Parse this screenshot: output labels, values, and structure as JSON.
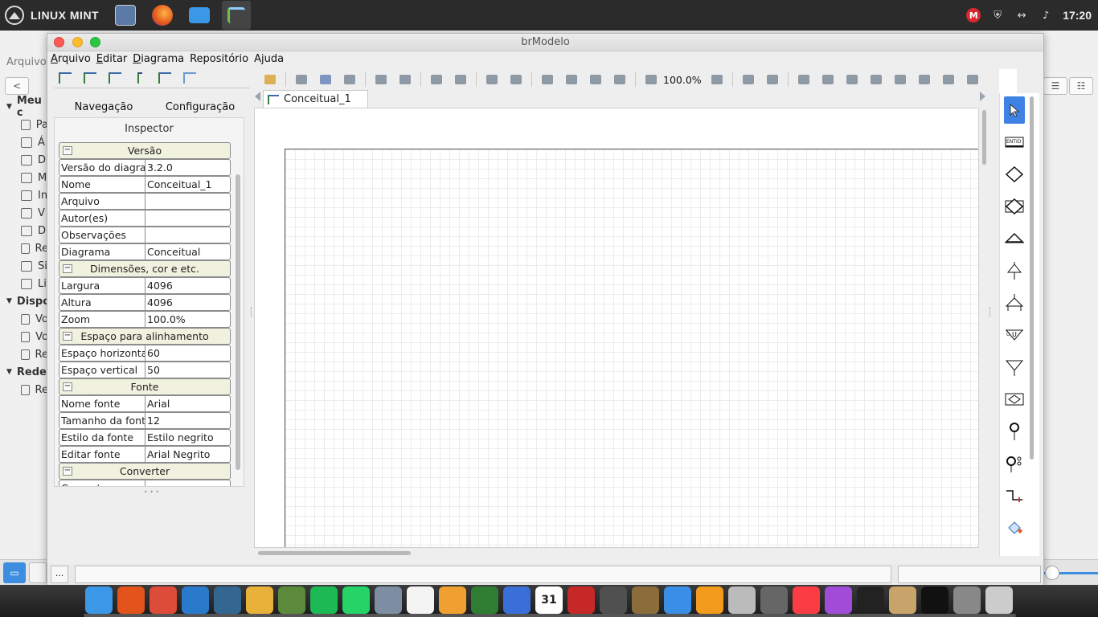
{
  "top_panel": {
    "brand": "LINUX MINT",
    "launchers": [
      "app-icon",
      "firefox-icon",
      "files-icon",
      "brmodelo-icon"
    ],
    "clock": "17:20"
  },
  "background_app": {
    "menu": "Arquivo",
    "sidebar": [
      {
        "type": "section",
        "label": "Meu c"
      },
      {
        "type": "item",
        "label": "Pa"
      },
      {
        "type": "item",
        "label": "Á"
      },
      {
        "type": "item",
        "label": "D"
      },
      {
        "type": "item",
        "label": "M"
      },
      {
        "type": "item",
        "label": "In"
      },
      {
        "type": "item",
        "label": "V"
      },
      {
        "type": "item",
        "label": "D"
      },
      {
        "type": "item",
        "label": "Re"
      },
      {
        "type": "item",
        "label": "Si"
      },
      {
        "type": "item",
        "label": "Li"
      },
      {
        "type": "section",
        "label": "Dispo"
      },
      {
        "type": "item",
        "label": "Vo"
      },
      {
        "type": "item",
        "label": "Vo"
      },
      {
        "type": "item",
        "label": "Re"
      },
      {
        "type": "section",
        "label": "Rede"
      },
      {
        "type": "item",
        "label": "Re"
      }
    ]
  },
  "window": {
    "title": "brModelo",
    "menu": [
      {
        "first": "A",
        "rest": "rquivo"
      },
      {
        "first": "E",
        "rest": "ditar"
      },
      {
        "first": "D",
        "rest": "iagrama"
      },
      {
        "first": "",
        "rest": "Repositório"
      },
      {
        "first": "",
        "rest": "Ajuda"
      }
    ],
    "left_tabs": [
      "Navegação",
      "Configuração"
    ],
    "inspector_title": "Inspector",
    "properties": [
      {
        "type": "section",
        "label": "Versão"
      },
      {
        "type": "row",
        "key": "Versão do diagra",
        "value": "3.2.0"
      },
      {
        "type": "row",
        "key": "Nome",
        "value": "Conceitual_1"
      },
      {
        "type": "row",
        "key": "Arquivo",
        "value": ""
      },
      {
        "type": "row",
        "key": "Autor(es)",
        "value": ""
      },
      {
        "type": "row",
        "key": "Observações",
        "value": ""
      },
      {
        "type": "row",
        "key": "Diagrama",
        "value": "Conceitual"
      },
      {
        "type": "section",
        "label": "Dimensões, cor e etc."
      },
      {
        "type": "row",
        "key": "Largura",
        "value": "4096"
      },
      {
        "type": "row",
        "key": "Altura",
        "value": "4096"
      },
      {
        "type": "row",
        "key": "Zoom",
        "value": "100.0%"
      },
      {
        "type": "section",
        "label": "Espaço para alinhamento"
      },
      {
        "type": "row",
        "key": "Espaço horizonta",
        "value": "60"
      },
      {
        "type": "row",
        "key": "Espaço vertical",
        "value": "50"
      },
      {
        "type": "section",
        "label": "Fonte"
      },
      {
        "type": "row",
        "key": "Nome fonte",
        "value": "Arial"
      },
      {
        "type": "row",
        "key": "Tamanho da font",
        "value": "12"
      },
      {
        "type": "row",
        "key": "Estilo da fonte",
        "value": "Estilo negrito"
      },
      {
        "type": "row",
        "key": "Editar fonte",
        "value": "Arial Negrito"
      },
      {
        "type": "section",
        "label": "Converter"
      },
      {
        "type": "row",
        "key": "Converter",
        "value": ""
      }
    ],
    "zoom": "100.0%",
    "document_tab": "Conceitual_1",
    "palette": [
      {
        "icon": "pointer-icon",
        "selected": true,
        "label": ""
      },
      {
        "icon": "entity-icon",
        "selected": false,
        "label": "ENTID"
      },
      {
        "icon": "relationship-icon",
        "selected": false,
        "label": ""
      },
      {
        "icon": "associative-entity-icon",
        "selected": false,
        "label": ""
      },
      {
        "icon": "specialization-icon",
        "selected": false,
        "label": ""
      },
      {
        "icon": "exclusive-specialization-icon",
        "selected": false,
        "label": ""
      },
      {
        "icon": "nonexclusive-specialization-icon",
        "selected": false,
        "label": ""
      },
      {
        "icon": "union-icon",
        "selected": false,
        "label": "U"
      },
      {
        "icon": "partial-union-icon",
        "selected": false,
        "label": ""
      },
      {
        "icon": "self-relationship-icon",
        "selected": false,
        "label": ""
      },
      {
        "icon": "attribute-icon",
        "selected": false,
        "label": ""
      },
      {
        "icon": "composite-attribute-icon",
        "selected": false,
        "label": ""
      },
      {
        "icon": "link-icon",
        "selected": false,
        "label": ""
      },
      {
        "icon": "paint-icon",
        "selected": false,
        "label": ""
      }
    ],
    "status_button": "..."
  },
  "colors": {
    "accent": "#3e82e4",
    "section_bg": "#f1f1df",
    "close": "#fc5b57",
    "minimize": "#fdbc2e",
    "maximize": "#2ac840"
  },
  "dock": [
    "files-icon",
    "firefox-icon",
    "chrome-icon",
    "vscode-icon",
    "postgres-icon",
    "star-icon",
    "brmodelo-icon",
    "spotify-icon",
    "whatsapp-icon",
    "mail-icon",
    "notes-icon",
    "presentation-icon",
    "chart-icon",
    "keynote-icon",
    "calendar-icon",
    "check-icon",
    "inkscape-icon",
    "gimp-icon",
    "chat-icon",
    "xampp-icon",
    "dvd-icon",
    "disk-icon",
    "music-icon",
    "video-icon",
    "monitor-icon",
    "archive-icon",
    "terminal-icon",
    "settings-icon",
    "trash-icon"
  ],
  "dock_calendar_day": "31"
}
